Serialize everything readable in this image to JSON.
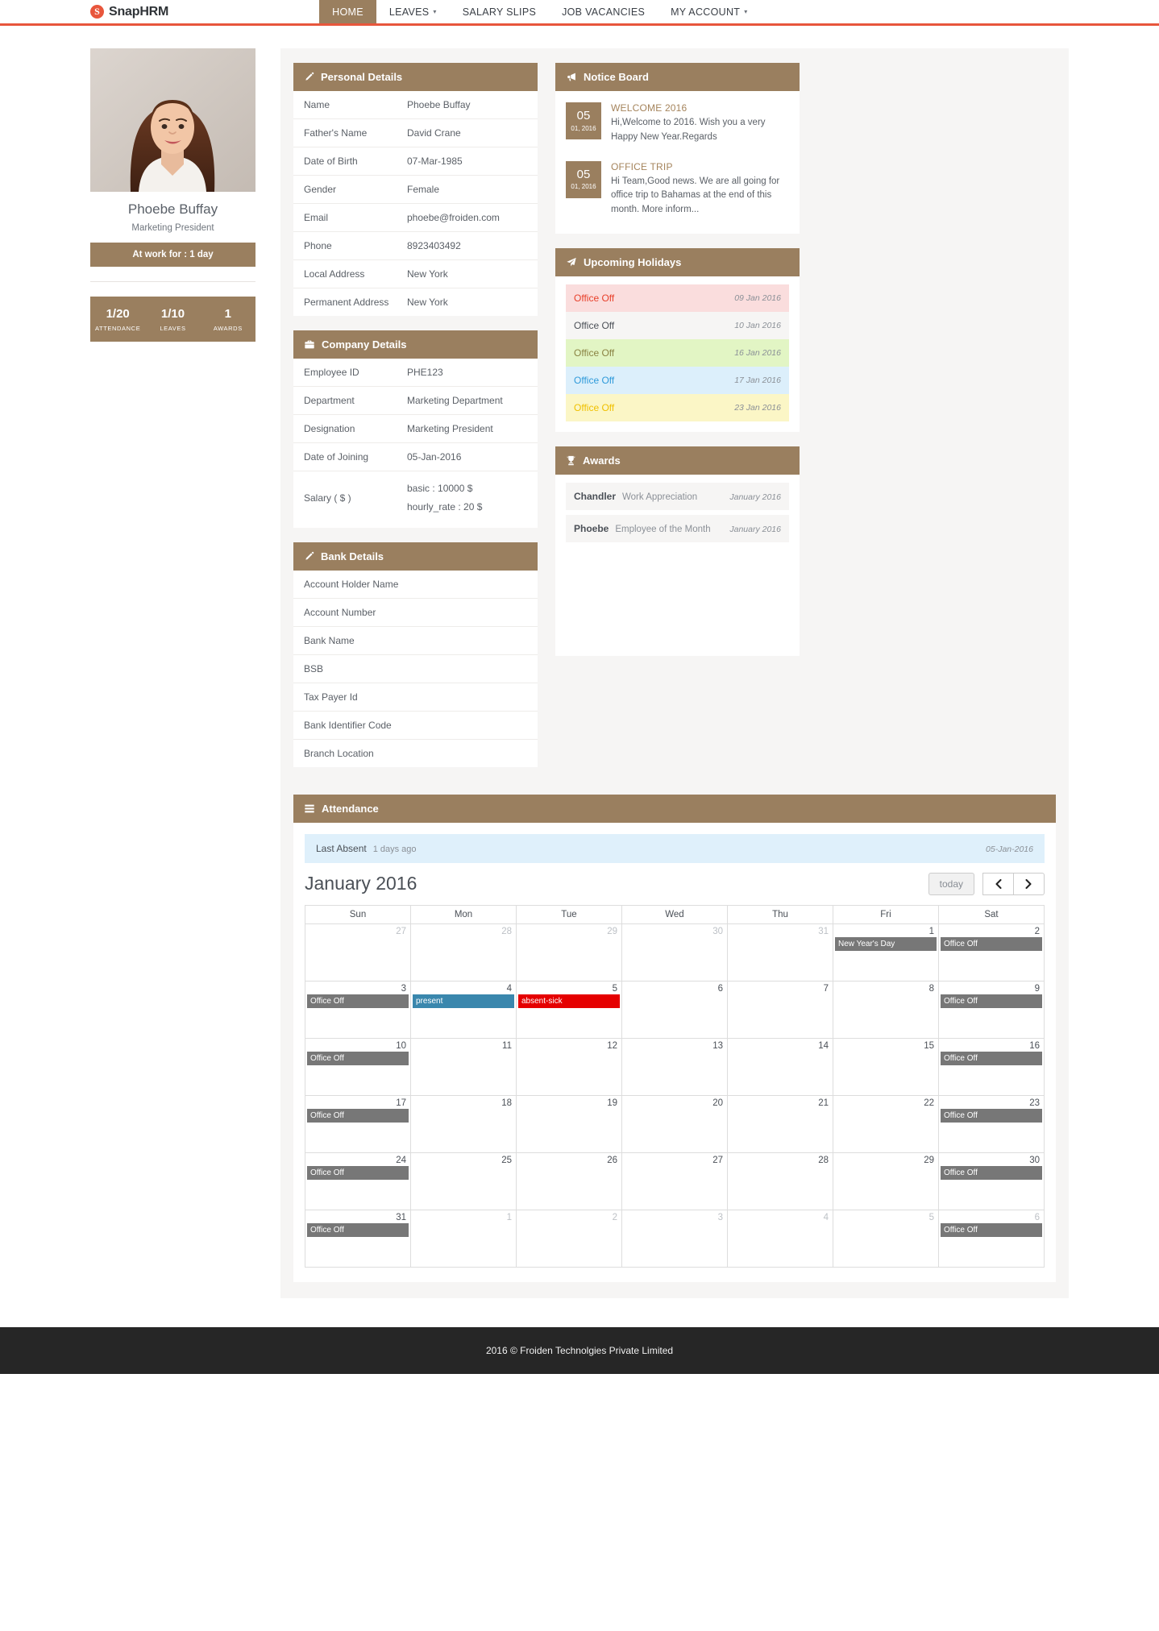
{
  "brand": {
    "mark": "S",
    "name": "SnapHRM"
  },
  "nav": {
    "items": [
      {
        "label": "HOME",
        "active": true,
        "caret": false
      },
      {
        "label": "LEAVES",
        "active": false,
        "caret": true
      },
      {
        "label": "SALARY SLIPS",
        "active": false,
        "caret": false
      },
      {
        "label": "JOB VACANCIES",
        "active": false,
        "caret": false
      },
      {
        "label": "MY ACCOUNT",
        "active": false,
        "caret": true
      }
    ]
  },
  "profile": {
    "name": "Phoebe Buffay",
    "role": "Marketing President",
    "at_work": "At work for : 1 day",
    "stats": [
      {
        "value": "1/20",
        "label": "ATTENDANCE"
      },
      {
        "value": "1/10",
        "label": "LEAVES"
      },
      {
        "value": "1",
        "label": "AWARDS"
      }
    ]
  },
  "personal_details": {
    "title": "Personal Details",
    "icon": "pencil-icon",
    "rows": [
      {
        "label": "Name",
        "value": "Phoebe Buffay"
      },
      {
        "label": "Father's Name",
        "value": "David Crane"
      },
      {
        "label": "Date of Birth",
        "value": "07-Mar-1985"
      },
      {
        "label": "Gender",
        "value": "Female"
      },
      {
        "label": "Email",
        "value": "phoebe@froiden.com"
      },
      {
        "label": "Phone",
        "value": "8923403492"
      },
      {
        "label": "Local Address",
        "value": "New York"
      },
      {
        "label": "Permanent Address",
        "value": "New York"
      }
    ]
  },
  "company_details": {
    "title": "Company Details",
    "icon": "briefcase-icon",
    "rows": [
      {
        "label": "Employee ID",
        "value": "PHE123"
      },
      {
        "label": "Department",
        "value": "Marketing Department"
      },
      {
        "label": "Designation",
        "value": "Marketing President"
      },
      {
        "label": "Date of Joining",
        "value": "05-Jan-2016"
      }
    ],
    "salary_label": "Salary ( $ )",
    "salary_lines": [
      "basic : 10000 $",
      "hourly_rate : 20 $"
    ]
  },
  "bank_details": {
    "title": "Bank Details",
    "icon": "pencil-icon",
    "rows": [
      {
        "label": "Account Holder Name",
        "value": ""
      },
      {
        "label": "Account Number",
        "value": ""
      },
      {
        "label": "Bank Name",
        "value": ""
      },
      {
        "label": "BSB",
        "value": ""
      },
      {
        "label": "Tax Payer Id",
        "value": ""
      },
      {
        "label": "Bank Identifier Code",
        "value": ""
      },
      {
        "label": "Branch Location",
        "value": ""
      }
    ]
  },
  "notice_board": {
    "title": "Notice Board",
    "icon": "megaphone-icon",
    "notices": [
      {
        "day": "05",
        "month_year": "01, 2016",
        "title": "WELCOME 2016",
        "body": "Hi,Welcome to 2016. Wish you a very Happy New Year.Regards"
      },
      {
        "day": "05",
        "month_year": "01, 2016",
        "title": "OFFICE TRIP",
        "body": "Hi Team,Good news. We are all going for office trip to Bahamas at the end of this month. More inform..."
      }
    ]
  },
  "upcoming_holidays": {
    "title": "Upcoming Holidays",
    "icon": "paper-plane-icon",
    "items": [
      {
        "name": "Office Off",
        "date": "09 Jan 2016",
        "bg": "#fadddd",
        "color": "#e8402a"
      },
      {
        "name": "Office Off",
        "date": "10 Jan 2016",
        "bg": "#f6f5f4",
        "color": "#4b5057"
      },
      {
        "name": "Office Off",
        "date": "16 Jan 2016",
        "bg": "#e2f5c4",
        "color": "#8a8343"
      },
      {
        "name": "Office Off",
        "date": "17 Jan 2016",
        "bg": "#dceffb",
        "color": "#2f9ada"
      },
      {
        "name": "Office Off",
        "date": "23 Jan 2016",
        "bg": "#fbf6c6",
        "color": "#f0c000"
      }
    ]
  },
  "awards": {
    "title": "Awards",
    "icon": "trophy-icon",
    "items": [
      {
        "who": "Chandler",
        "what": "Work Appreciation",
        "when": "January 2016"
      },
      {
        "who": "Phoebe",
        "what": "Employee of the Month",
        "when": "January 2016"
      }
    ]
  },
  "attendance": {
    "title": "Attendance",
    "icon": "list-icon",
    "last_absent_label": "Last Absent",
    "last_absent_ago": "1 days ago",
    "last_absent_date": "05-Jan-2016",
    "calendar_title": "January 2016",
    "today_button": "today",
    "prev_button": "prev-month-icon",
    "next_button": "next-month-icon",
    "weekdays": [
      "Sun",
      "Mon",
      "Tue",
      "Wed",
      "Thu",
      "Fri",
      "Sat"
    ],
    "weeks": [
      [
        {
          "day": "27",
          "other": true
        },
        {
          "day": "28",
          "other": true
        },
        {
          "day": "29",
          "other": true
        },
        {
          "day": "30",
          "other": true
        },
        {
          "day": "31",
          "other": true
        },
        {
          "day": "1",
          "off": true,
          "events": [
            {
              "label": "New Year's Day",
              "type": "grey"
            }
          ]
        },
        {
          "day": "2",
          "off": true,
          "events": [
            {
              "label": "Office Off",
              "type": "grey"
            }
          ]
        }
      ],
      [
        {
          "day": "3",
          "off": true,
          "events": [
            {
              "label": "Office Off",
              "type": "grey"
            }
          ]
        },
        {
          "day": "4",
          "events": [
            {
              "label": "present",
              "type": "blue"
            }
          ]
        },
        {
          "day": "5",
          "events": [
            {
              "label": "absent-sick",
              "type": "red"
            }
          ]
        },
        {
          "day": "6",
          "today": true
        },
        {
          "day": "7"
        },
        {
          "day": "8"
        },
        {
          "day": "9",
          "off": true,
          "events": [
            {
              "label": "Office Off",
              "type": "grey"
            }
          ]
        }
      ],
      [
        {
          "day": "10",
          "off": true,
          "events": [
            {
              "label": "Office Off",
              "type": "grey"
            }
          ]
        },
        {
          "day": "11"
        },
        {
          "day": "12"
        },
        {
          "day": "13"
        },
        {
          "day": "14"
        },
        {
          "day": "15"
        },
        {
          "day": "16",
          "off": true,
          "events": [
            {
              "label": "Office Off",
              "type": "grey"
            }
          ]
        }
      ],
      [
        {
          "day": "17",
          "off": true,
          "events": [
            {
              "label": "Office Off",
              "type": "grey"
            }
          ]
        },
        {
          "day": "18"
        },
        {
          "day": "19"
        },
        {
          "day": "20"
        },
        {
          "day": "21"
        },
        {
          "day": "22"
        },
        {
          "day": "23",
          "off": true,
          "events": [
            {
              "label": "Office Off",
              "type": "grey"
            }
          ]
        }
      ],
      [
        {
          "day": "24",
          "off": true,
          "events": [
            {
              "label": "Office Off",
              "type": "grey"
            }
          ]
        },
        {
          "day": "25"
        },
        {
          "day": "26"
        },
        {
          "day": "27"
        },
        {
          "day": "28"
        },
        {
          "day": "29"
        },
        {
          "day": "30",
          "off": true,
          "events": [
            {
              "label": "Office Off",
              "type": "grey"
            }
          ]
        }
      ],
      [
        {
          "day": "31",
          "off": true,
          "events": [
            {
              "label": "Office Off",
              "type": "grey"
            }
          ]
        },
        {
          "day": "1",
          "other": true
        },
        {
          "day": "2",
          "other": true
        },
        {
          "day": "3",
          "other": true
        },
        {
          "day": "4",
          "other": true
        },
        {
          "day": "5",
          "other": true
        },
        {
          "day": "6",
          "other": true,
          "off": true,
          "events": [
            {
              "label": "Office Off",
              "type": "grey"
            }
          ]
        }
      ]
    ]
  },
  "footer": {
    "text": "2016 © Froiden Technolgies Private Limited"
  },
  "colors": {
    "accent_brown": "#9a7f5f",
    "brand_orange": "#e8563c",
    "footer_bg": "#262626"
  }
}
